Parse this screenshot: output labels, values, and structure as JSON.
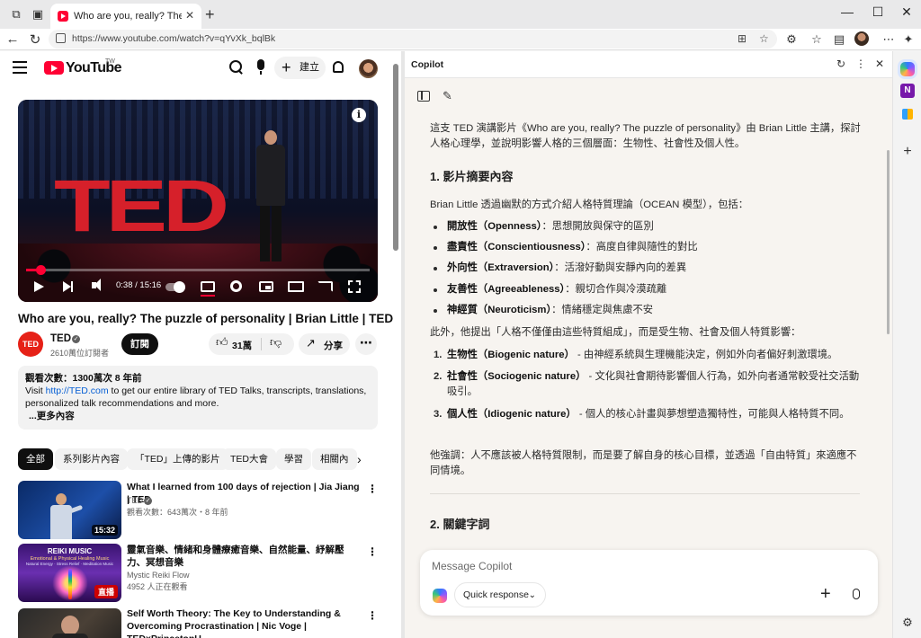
{
  "browser": {
    "tab_title": "Who are you, really? The puzzle o",
    "url": "https://www.youtube.com/watch?v=qYvXk_bqlBk",
    "new_tab": "+",
    "win_min": "—",
    "win_max": "☐",
    "win_close": "✕",
    "tab_close": "✕"
  },
  "youtube": {
    "logo_word": "YouTube",
    "logo_region": "TW",
    "create_label": "建立",
    "player": {
      "time": "0:38 / 15:16",
      "progress_fraction": 0.042,
      "stage_logo": "TED"
    },
    "video_title": "Who are you, really? The puzzle of personality | Brian Little | TED",
    "channel": {
      "logo": "TED",
      "name": "TED",
      "subs": "2610萬位訂閱者",
      "subscribe": "訂閱"
    },
    "likes": "31萬",
    "share": "分享",
    "description": {
      "stats": "觀看次數：1300萬次  8 年前",
      "line_pre": "Visit ",
      "link": "http://TED.com",
      "line_post": " to get our entire library of TED Talks, transcripts, translations, personalized talk recommendations and more.",
      "more": "...更多內容"
    },
    "chips": [
      "全部",
      "系列影片內容",
      "「TED」上傳的影片",
      "TED大會",
      "學習",
      "相關內"
    ],
    "related": [
      {
        "title": "What I learned from 100 days of rejection | Jia Jiang | TED",
        "channel": "TED",
        "meta": "觀看次數：643萬次・8 年前",
        "duration": "15:32"
      },
      {
        "title": "靈氣音樂、情緒和身體療癒音樂、自然能量、紓解壓力、冥想音樂",
        "channel": "Mystic Reiki Flow",
        "meta": "4952 人正在觀看",
        "live": "直播",
        "thumb_title": "REIKI MUSIC",
        "thumb_sub1": "Emotional & Physical Healing Music",
        "thumb_sub2": "Natural Energy · Stress Relief · Meditation Music"
      },
      {
        "title": "Self Worth Theory: The Key to Understanding & Overcoming Procrastination | Nic Voge | TEDxPrincetonU"
      }
    ]
  },
  "copilot": {
    "header_title": "Copilot",
    "intro": "這支 TED 演講影片《Who are you, really? The puzzle of personality》由 Brian Little 主講，探討人格心理學，並說明影響人格的三個層面：生物性、社會性及個人性。",
    "section1": "1. 影片摘要內容",
    "s1_intro": "Brian Little 透過幽默的方式介紹人格特質理論（OCEAN 模型），包括：",
    "bullets": [
      {
        "term": "開放性（Openness）",
        "desc": "：思想開放與保守的區別"
      },
      {
        "term": "盡責性（Conscientiousness）",
        "desc": "：高度自律與隨性的對比"
      },
      {
        "term": "外向性（Extraversion）",
        "desc": "：活潑好動與安靜內向的差異"
      },
      {
        "term": "友善性（Agreeableness）",
        "desc": "：親切合作與冷漠疏離"
      },
      {
        "term": "神經質（Neuroticism）",
        "desc": "：情緒穩定與焦慮不安"
      }
    ],
    "mid": "此外，他提出「人格不僅僅由這些特質組成」，而是受生物、社會及個人特質影響：",
    "numbered": [
      {
        "num": "1.",
        "term": "生物性（Biogenic nature）",
        "desc": " - 由神經系統與生理機能決定，例如外向者偏好刺激環境。"
      },
      {
        "num": "2.",
        "term": "社會性（Sociogenic nature）",
        "desc": " - 文化與社會期待影響個人行為，如外向者通常較受社交活動吸引。"
      },
      {
        "num": "3.",
        "term": "個人性（Idiogenic nature）",
        "desc": " - 個人的核心計畫與夢想塑造獨特性，可能與人格特質不同。"
      }
    ],
    "closing": "他強調：人不應該被人格特質限制，而是要了解自身的核心目標，並透過「自由特質」來適應不同情境。",
    "section2": "2. 關鍵字詞",
    "composer": {
      "placeholder": "Message Copilot",
      "mode": "Quick response"
    }
  }
}
